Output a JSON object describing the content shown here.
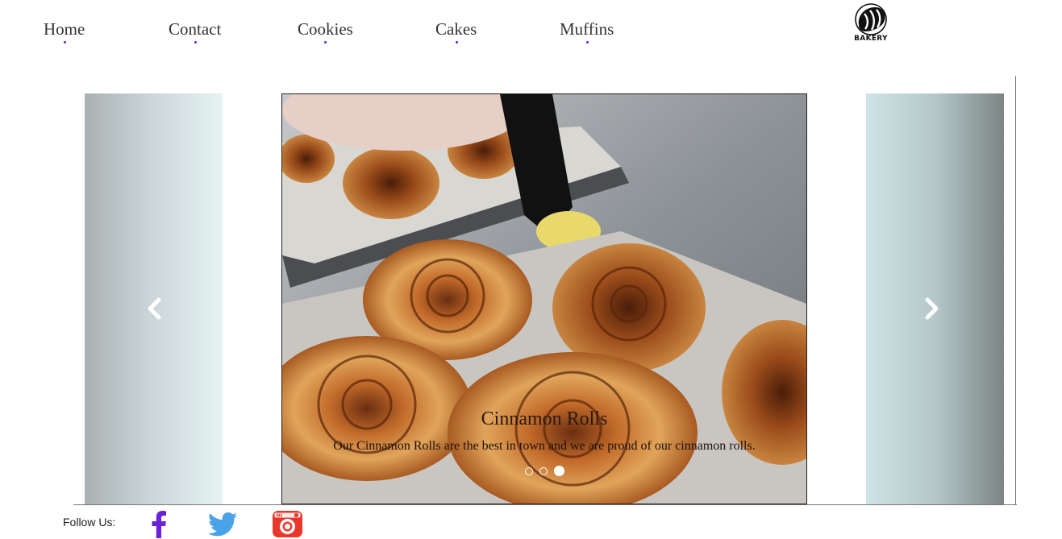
{
  "nav": {
    "items": [
      {
        "label": "Home"
      },
      {
        "label": "Contact"
      },
      {
        "label": "Cookies"
      },
      {
        "label": "Cakes"
      },
      {
        "label": "Muffins"
      }
    ],
    "logo_text": "BAKERY"
  },
  "carousel": {
    "slide_title": "Cinnamon Rolls",
    "slide_text": "Our Cinnamon Rolls are the best in town and we are proud of our cinnamon rolls.",
    "slide_count": 3,
    "active_index": 3,
    "prev_icon": "chevron-left-icon",
    "next_icon": "chevron-right-icon"
  },
  "footer": {
    "follow_label": "Follow Us:",
    "social": [
      {
        "icon": "facebook-icon",
        "color": "#6b21d8"
      },
      {
        "icon": "twitter-icon",
        "color": "#4aa3e8"
      },
      {
        "icon": "instagram-icon",
        "color": "#e8382c"
      }
    ]
  },
  "colors": {
    "nav_text": "#333333",
    "nav_dot": "#6b21d8"
  }
}
